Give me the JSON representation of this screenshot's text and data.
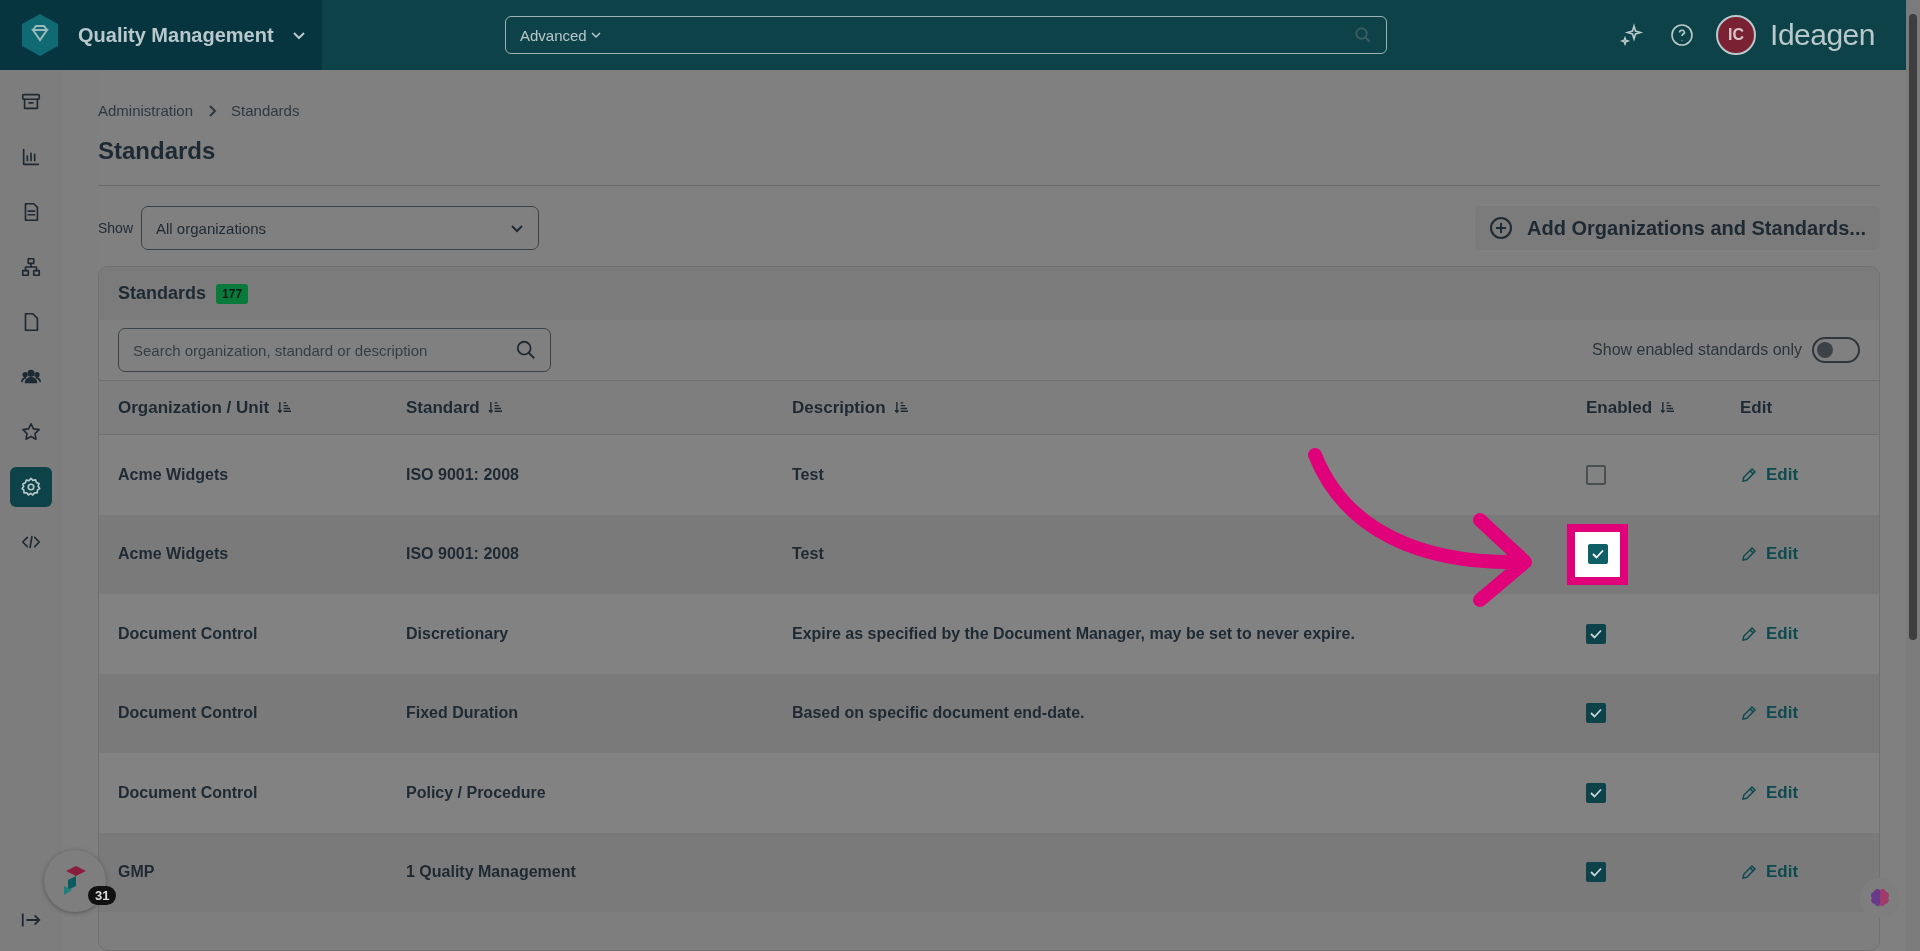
{
  "topbar": {
    "app_name": "Quality Management",
    "search": {
      "scope": "Advanced"
    },
    "avatar_initials": "IC",
    "brand": "Ideagen"
  },
  "sidebar": {
    "items": [
      {
        "selected": false
      },
      {
        "selected": false
      },
      {
        "selected": false
      },
      {
        "selected": false
      },
      {
        "selected": false
      },
      {
        "selected": false
      },
      {
        "selected": false
      },
      {
        "selected": true
      },
      {
        "selected": false
      }
    ]
  },
  "breadcrumb": [
    "Administration",
    "Standards"
  ],
  "page_title": "Standards",
  "filter": {
    "label": "Show",
    "value": "All organizations"
  },
  "add_button": "Add Organizations and Standards...",
  "panel": {
    "title": "Standards",
    "count": "177",
    "search": {
      "placeholder": "Search organization, standard or description"
    },
    "toggle": {
      "label": "Show enabled standards only",
      "on": false
    },
    "columns": [
      "Organization / Unit",
      "Standard",
      "Description",
      "Enabled",
      "Edit"
    ],
    "rows": [
      {
        "organization": "Acme Widgets",
        "standard": "ISO 9001: 2008",
        "description": "Test",
        "enabled": false,
        "highlighted": false,
        "edit": "Edit"
      },
      {
        "organization": "Acme Widgets",
        "standard": "ISO 9001: 2008",
        "description": "Test",
        "enabled": true,
        "highlighted": true,
        "edit": "Edit"
      },
      {
        "organization": "Document Control",
        "standard": "Discretionary",
        "description": "Expire as specified by the Document Manager, may be set to never expire.",
        "enabled": true,
        "highlighted": false,
        "edit": "Edit"
      },
      {
        "organization": "Document Control",
        "standard": "Fixed Duration",
        "description": "Based on specific document end-date.",
        "enabled": true,
        "highlighted": false,
        "edit": "Edit"
      },
      {
        "organization": "Document Control",
        "standard": "Policy / Procedure",
        "description": "",
        "enabled": true,
        "highlighted": false,
        "edit": "Edit"
      },
      {
        "organization": "GMP",
        "standard": "1 Quality Management",
        "description": "",
        "enabled": true,
        "highlighted": false,
        "edit": "Edit"
      }
    ]
  },
  "assistant_badge": "31"
}
